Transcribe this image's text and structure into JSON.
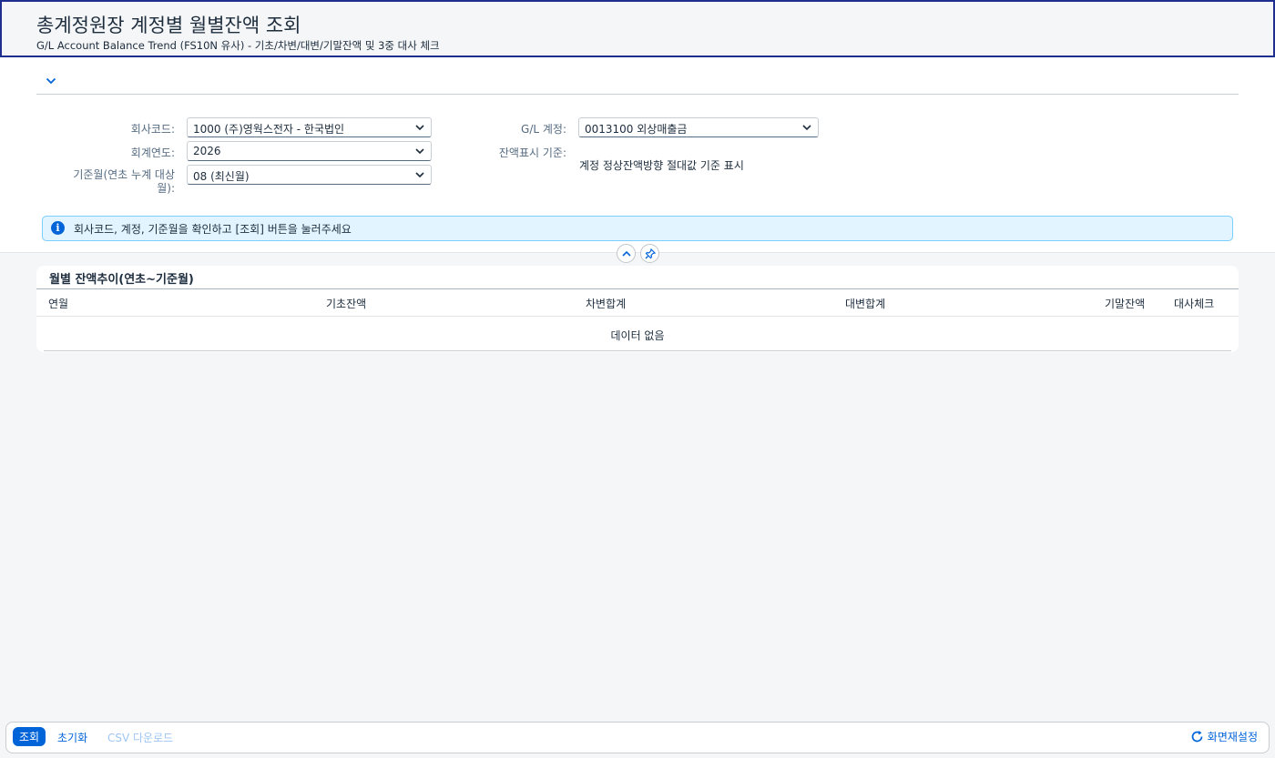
{
  "header": {
    "title": "총계정원장 계정별 월별잔액 조회",
    "subtitle": "G/L Account Balance Trend (FS10N 유사) - 기초/차변/대변/기말잔액 및 3중 대사 체크"
  },
  "filters": {
    "company_code": {
      "label": "회사코드:",
      "value": "1000 (주)영웍스전자 - 한국법인"
    },
    "fiscal_year": {
      "label": "회계연도:",
      "value": "2026"
    },
    "period": {
      "label_line1": "기준월(연초 누계 대상",
      "label_line2": "월):",
      "value": "08 (최신월)"
    },
    "gl_account": {
      "label": "G/L 계정:",
      "value": "0013100 외상매출금"
    },
    "balance_display": {
      "label": "잔액표시 기준:",
      "value": "계정 정상잔액방향 절대값 기준 표시"
    }
  },
  "message": {
    "text": "회사코드, 계정, 기준월을 확인하고 [조회] 버튼을 눌러주세요"
  },
  "table": {
    "title": "월별 잔액추이(연초~기준월)",
    "columns": [
      "연월",
      "기초잔액",
      "차변합계",
      "대변합계",
      "기말잔액",
      "대사체크"
    ],
    "empty_text": "데이터 없음"
  },
  "footer": {
    "search": "조회",
    "reset": "초기화",
    "csv": "CSV 다운로드",
    "screen_reset": "화면재설정"
  },
  "colors": {
    "accent": "#0064d9",
    "title_border": "#1f2f8f",
    "info_bg": "#e1f4ff"
  }
}
